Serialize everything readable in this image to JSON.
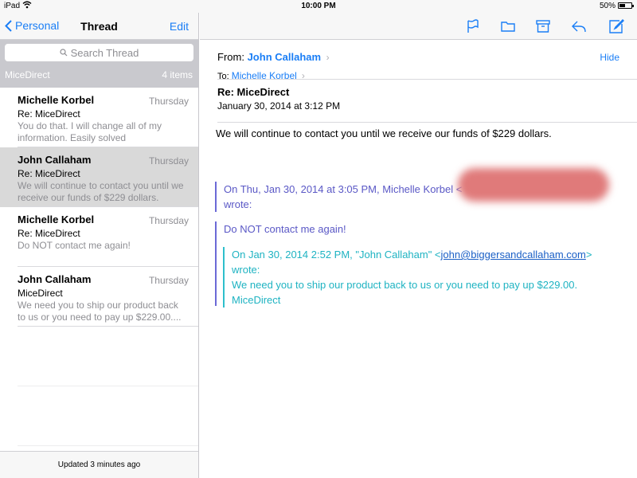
{
  "statusbar": {
    "device": "iPad",
    "time": "10:00 PM",
    "battery_pct": "50%",
    "battery_level": 0.5
  },
  "left": {
    "back_label": "Personal",
    "title": "Thread",
    "edit_label": "Edit",
    "search_placeholder": "Search Thread",
    "section": {
      "label": "MiceDirect",
      "count": "4 items"
    },
    "messages": [
      {
        "sender": "Michelle Korbel",
        "date": "Thursday",
        "subject": "Re: MiceDirect",
        "preview": "You do that. I will change all of my information. Easily solved"
      },
      {
        "sender": "John Callaham",
        "date": "Thursday",
        "subject": "Re: MiceDirect",
        "preview": "We will continue to contact you until we receive our funds of $229 dollars."
      },
      {
        "sender": "Michelle Korbel",
        "date": "Thursday",
        "subject": "Re: MiceDirect",
        "preview": "Do NOT contact me again!"
      },
      {
        "sender": "John Callaham",
        "date": "Thursday",
        "subject": "MiceDirect",
        "preview": "We need you to ship our product back to us or you need to pay up $229.00...."
      }
    ],
    "footer": "Updated 3 minutes ago"
  },
  "toolbar": {
    "icons": [
      "flag-icon",
      "folder-icon",
      "archive-icon",
      "reply-icon",
      "compose-icon"
    ]
  },
  "email": {
    "from_label": "From:",
    "from_name": "John Callaham",
    "hide_label": "Hide",
    "to_label": "To:",
    "to_name": "Michelle Korbel",
    "subject": "Re: MiceDirect",
    "date": "January 30, 2014 at 3:12 PM",
    "body": "We will continue to contact you until we receive our funds of $229 dollars.",
    "quote1_header": "On Thu, Jan 30, 2014 at 3:05 PM, Michelle Korbel <",
    "quote1_wrote": "wrote:",
    "quote2_body": "Do NOT contact me again!",
    "quote3_header_pre": "On Jan 30, 2014 2:52 PM, \"John Callaham\" <",
    "quote3_email": "john@biggersandcallaham.com",
    "quote3_header_post": ">",
    "quote3_wrote": "wrote:",
    "quote3_body": "We need you to ship our product back to us or you need to pay up $229.00.",
    "quote3_sign": "MiceDirect"
  }
}
